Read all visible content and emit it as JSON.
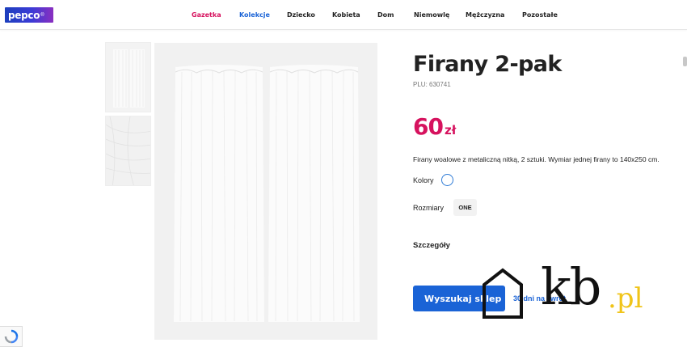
{
  "header": {
    "logo_text": "pepco",
    "logo_mark": "®",
    "nav": [
      {
        "label": "Gazetka",
        "color": "#d6125e"
      },
      {
        "label": "Kolekcje",
        "color": "#1a63d6"
      },
      {
        "label": "Dziecko",
        "color": "#222222"
      },
      {
        "label": "Kobieta",
        "color": "#222222"
      },
      {
        "label": "Dom",
        "color": "#222222"
      },
      {
        "label": "Niemowlę",
        "color": "#222222"
      },
      {
        "label": "Mężczyzna",
        "color": "#222222"
      },
      {
        "label": "Pozostałe",
        "color": "#222222"
      }
    ]
  },
  "product": {
    "title": "Firany 2-pak",
    "plu": "PLU: 630741",
    "price_value": "60",
    "price_currency": "zł",
    "description": "Firany woalowe z metaliczną nitką, 2 sztuki. Wymiar jednej firany to 140x250 cm.",
    "colors_label": "Kolory",
    "sizes_label": "Rozmiary",
    "size_value": "ONE",
    "details_label": "Szczegóły",
    "find_store_label": "Wyszukaj sklep",
    "returns_label": "30 dni na zwrot"
  },
  "watermark": {
    "brand": "kb",
    "suffix": ".pl"
  },
  "colors": {
    "accent_pink": "#d6125e",
    "accent_blue": "#1a63d6",
    "watermark_gold": "#f0c419"
  },
  "icons": {
    "recaptcha": "recaptcha-icon",
    "watermark_house": "house-icon"
  }
}
